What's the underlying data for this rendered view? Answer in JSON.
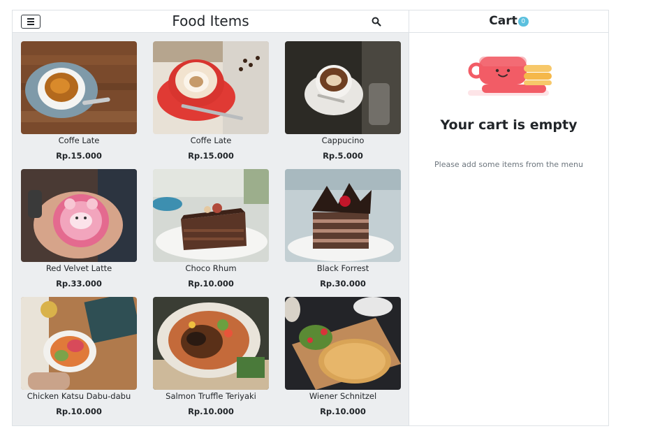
{
  "header": {
    "title": "Food Items"
  },
  "cart": {
    "title": "Cart",
    "count": "0",
    "empty_title": "Your cart is empty",
    "empty_message": "Please add some items from the menu"
  },
  "items": [
    {
      "name": "Coffe Late",
      "price": "Rp.15.000"
    },
    {
      "name": "Coffe Late",
      "price": "Rp.15.000"
    },
    {
      "name": "Cappucino",
      "price": "Rp.5.000"
    },
    {
      "name": "Red Velvet Latte",
      "price": "Rp.33.000"
    },
    {
      "name": "Choco Rhum",
      "price": "Rp.10.000"
    },
    {
      "name": "Black Forrest",
      "price": "Rp.30.000"
    },
    {
      "name": "Chicken Katsu Dabu-dabu",
      "price": "Rp.10.000"
    },
    {
      "name": "Salmon Truffle Teriyaki",
      "price": "Rp.10.000"
    },
    {
      "name": "Wiener Schnitzel",
      "price": "Rp.10.000"
    }
  ],
  "icons": {
    "menu": "hamburger-icon",
    "search": "search-icon",
    "cart_illustration": "empty-cup-illustration"
  },
  "colors": {
    "badge": "#5bc0de",
    "grid_bg": "#eceef0",
    "cup": "#f25c66"
  }
}
